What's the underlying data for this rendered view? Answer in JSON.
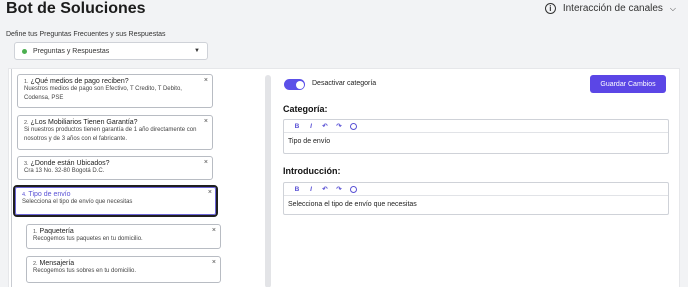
{
  "header": {
    "title": "Bot de Soluciones",
    "channel_label": "Interacción de canales"
  },
  "define_label": "Define tus Preguntas Frecuentes y sus Respuestas",
  "select": {
    "value": "Preguntas y Respuestas"
  },
  "cards": [
    {
      "num": "1.",
      "question": "¿Qué medios de pago reciben?",
      "answer": "Nuestros medios de pago son Efectivo, T Credito, T Debito, Codensa, PSE"
    },
    {
      "num": "2.",
      "question": "¿Los Mobiliarios Tienen Garantía?",
      "answer": "Si nuestros productos tienen garantía de 1 año directamente con nosotros y de 3 años con el fabricante."
    },
    {
      "num": "3.",
      "question": "¿Donde están Ubicados?",
      "answer": "Cra 13 No. 32-80 Bogotá D.C."
    },
    {
      "num": "4.",
      "question": "Tipo de envío",
      "answer": "Selecciona el tipo de envío que necesitas"
    }
  ],
  "subcards": [
    {
      "num": "1.",
      "question": "Paquetería",
      "answer": "Recogemos tus paquetes en tu domicilio."
    },
    {
      "num": "2.",
      "question": "Mensajería",
      "answer": "Recogemos tus sobres en tu domicilio."
    }
  ],
  "toggle_label": "Desactivar categoría",
  "save_label": "Guardar Cambios",
  "categoria": {
    "title": "Categoría:",
    "value": "Tipo de envío"
  },
  "introduccion": {
    "title": "Introducción:",
    "value": "Selecciona el tipo de envío que necesitas"
  },
  "close_glyph": "×",
  "toolbar": {
    "bold": "B",
    "italic": "I",
    "undo": "↶",
    "redo": "↷"
  },
  "colors": {
    "accent": "#5b46e6",
    "selected_border": "#1f1f1f",
    "status_dot": "#4caf50"
  }
}
